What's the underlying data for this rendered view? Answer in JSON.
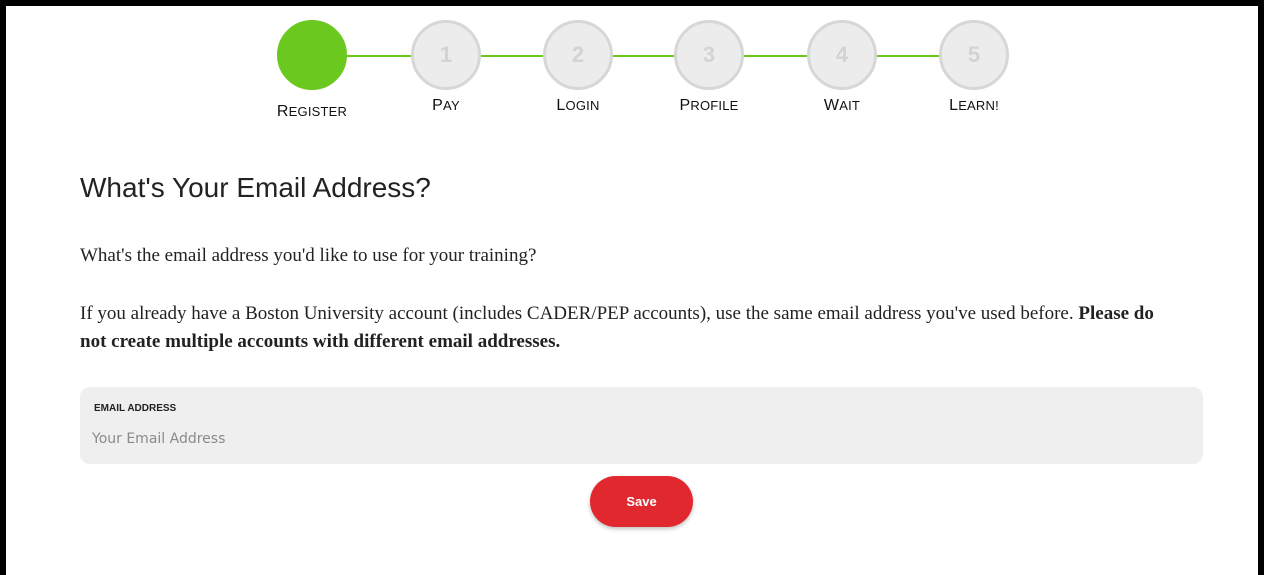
{
  "steps": [
    {
      "number": "",
      "label_first": "R",
      "label_rest": "EGISTER",
      "status": "done"
    },
    {
      "number": "1",
      "label_first": "P",
      "label_rest": "AY",
      "status": "pending"
    },
    {
      "number": "2",
      "label_first": "L",
      "label_rest": "OGIN",
      "status": "pending"
    },
    {
      "number": "3",
      "label_first": "P",
      "label_rest": "ROFILE",
      "status": "pending"
    },
    {
      "number": "4",
      "label_first": "W",
      "label_rest": "AIT",
      "status": "pending"
    },
    {
      "number": "5",
      "label_first": "L",
      "label_rest": "EARN!",
      "status": "pending"
    }
  ],
  "colors": {
    "done": "#6ac81f",
    "pending": "#ececec",
    "save": "#e0282e"
  },
  "heading": "What's Your Email Address?",
  "intro": "What's the email address you'd like to use for your training?",
  "notice": "If you already have a Boston University account (includes CADER/PEP accounts), use the same email address you've used before.",
  "notice_bold": "Please do not create multiple accounts with different email addresses.",
  "email_field": {
    "label": "EMAIL ADDRESS",
    "placeholder": "Your Email Address",
    "value": ""
  },
  "save_label": "Save"
}
